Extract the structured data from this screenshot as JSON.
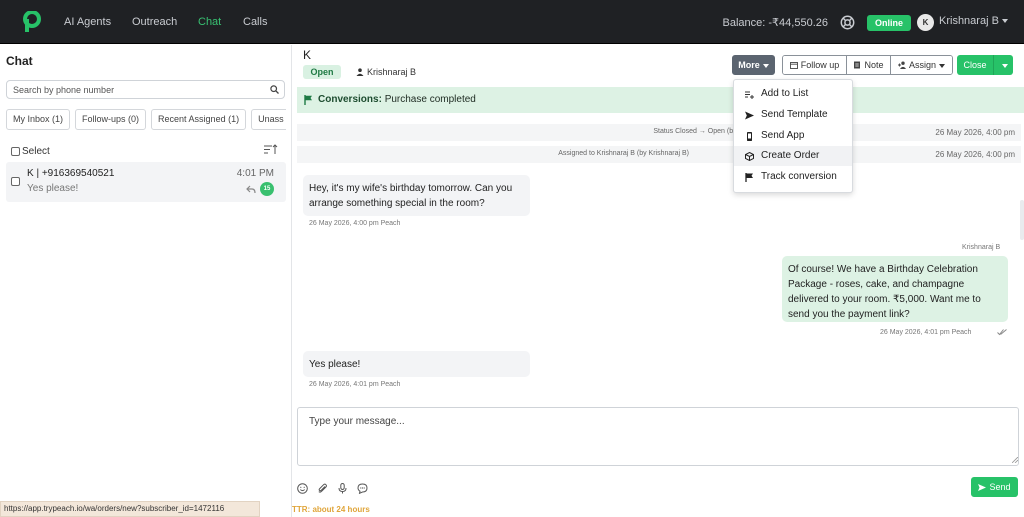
{
  "nav": {
    "items": [
      "AI Agents",
      "Outreach",
      "Chat",
      "Calls"
    ],
    "active_index": 2,
    "balance": "Balance: -₹44,550.26",
    "online_label": "Online",
    "user_initial": "K",
    "user_name": "Krishnaraj B"
  },
  "sidebar": {
    "title": "Chat",
    "search_placeholder": "Search by phone number",
    "filters": [
      "My Inbox (1)",
      "Follow-ups (0)",
      "Recent Assigned (1)",
      "Unass"
    ],
    "select_label": "Select",
    "conversations": [
      {
        "name": "K | +916369540521",
        "time": "4:01 PM",
        "preview": "Yes please!",
        "unread": "15"
      }
    ]
  },
  "header": {
    "contact_name": "K",
    "status": "Open",
    "assignee": "Krishnaraj B",
    "more_label": "More",
    "follow_up_label": "Follow up",
    "note_label": "Note",
    "assign_label": "Assign",
    "close_label": "Close"
  },
  "banner": {
    "label": "Conversions:",
    "text": "Purchase completed"
  },
  "menu": {
    "items": [
      "Add to List",
      "Send Template",
      "Send App",
      "Create Order",
      "Track conversion"
    ]
  },
  "events": [
    {
      "text": "Status Closed → Open (by Krishnaraj B)",
      "time": "26 May 2026, 4:00 pm"
    },
    {
      "text": "Assigned to Krishnaraj B (by Krishnaraj B)",
      "time": "26 May 2026, 4:00 pm"
    }
  ],
  "messages": [
    {
      "direction": "in",
      "text": "Hey, it's my wife's birthday tomorrow. Can you arrange something special in the room?",
      "meta": "26 May 2026, 4:00 pm  Peach"
    },
    {
      "direction": "out",
      "sender": "Krishnaraj B",
      "text": "Of course! We have a Birthday Celebration Package - roses, cake, and champagne delivered to your room. ₹5,000. Want me to send you the payment link?",
      "meta": "26 May 2026, 4:01 pm  Peach"
    },
    {
      "direction": "in",
      "text": "Yes please!",
      "meta": "26 May 2026, 4:01 pm  Peach"
    }
  ],
  "composer": {
    "placeholder": "Type your message...",
    "send_label": "Send"
  },
  "footer": {
    "status_url": "https://app.trypeach.io/wa/orders/new?subscriber_id=1472116",
    "ttr": "TTR: about 24 hours"
  },
  "colors": {
    "accent": "#27c268",
    "topbar": "#1f2124",
    "banner_bg": "#ddf2e4"
  }
}
